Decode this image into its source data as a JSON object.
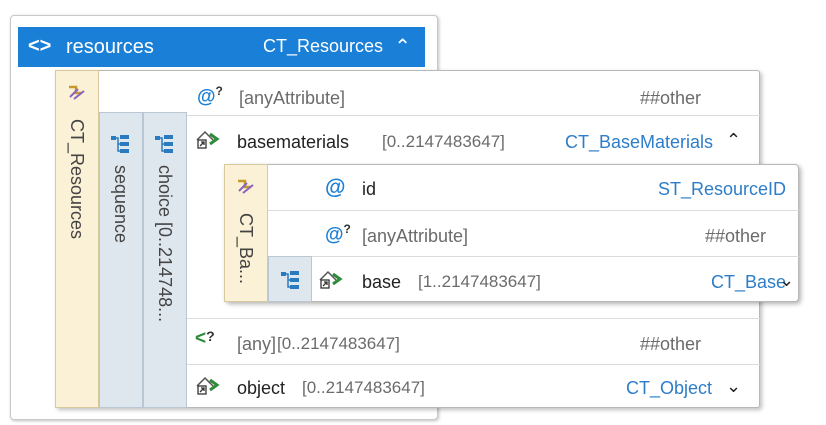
{
  "header": {
    "name": "resources",
    "type": "CT_Resources",
    "chevron": "⌃"
  },
  "outer_box": {
    "ct_label": "CT_Resources",
    "sequence_label": "sequence",
    "choice_label": "choice  [0..214748..."
  },
  "rows": {
    "any_attribute": {
      "label": "[anyAttribute]",
      "value": "##other"
    },
    "basematerials": {
      "name": "basematerials",
      "range": "[0..2147483647]",
      "type": "CT_BaseMaterials",
      "chevron": "⌃"
    },
    "any": {
      "label": "[any]",
      "range": "[0..2147483647]",
      "value": "##other"
    },
    "object": {
      "name": "object",
      "range": "[0..2147483647]",
      "type": "CT_Object",
      "chevron": "⌄"
    }
  },
  "inner_box": {
    "ct_label": "CT_Ba...",
    "id": {
      "name": "id",
      "type": "ST_ResourceID"
    },
    "any_attribute": {
      "label": "[anyAttribute]",
      "value": "##other"
    },
    "base": {
      "name": "base",
      "range": "[1..2147483647]",
      "type": "CT_Base",
      "chevron": "⌄"
    }
  },
  "icons": {
    "element": "element-icon",
    "attribute": "attribute-icon",
    "any_attribute": "any-attribute-icon",
    "complex_type": "complex-type-icon",
    "sequence": "sequence-icon",
    "choice": "choice-icon",
    "any": "any-icon",
    "element_ref": "element-reference-icon"
  },
  "colors": {
    "header_bg": "#1a7fd6",
    "ct_bg": "#fbf1d6",
    "group_bg": "#dfe7ee",
    "type_text": "#2d7dc8"
  }
}
